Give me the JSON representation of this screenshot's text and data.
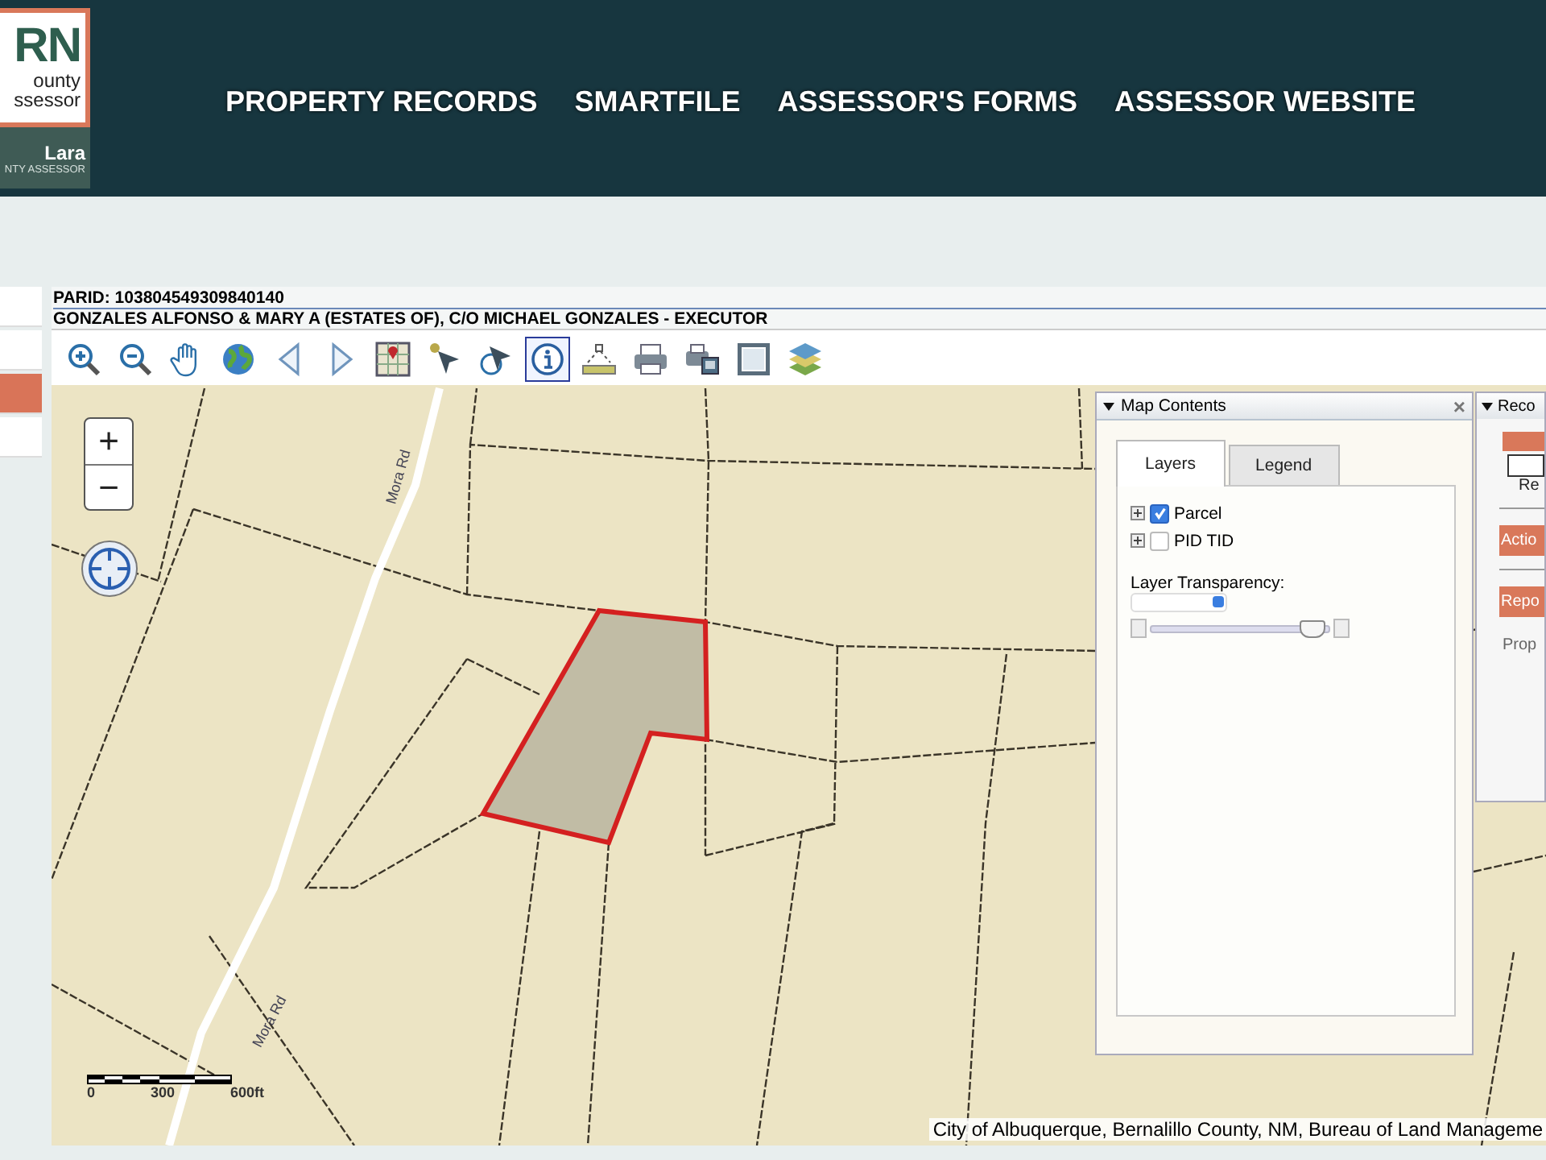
{
  "header": {
    "logo": {
      "letters": "RN",
      "line_1": "ounty",
      "line_2": "ssessor",
      "name": "Lara",
      "subtitle": "NTY ASSESSOR"
    },
    "nav": [
      "PROPERTY RECORDS",
      "SMARTFILE",
      "ASSESSOR'S FORMS",
      "ASSESSOR WEBSITE"
    ]
  },
  "left_panel": {
    "items": [
      {
        "selected": false
      },
      {
        "selected": false
      },
      {
        "selected": true
      },
      {
        "selected": false
      }
    ]
  },
  "record": {
    "parid": "PARID: 103804549309840140",
    "owner": "GONZALES ALFONSO & MARY A (ESTATES OF), C/O MICHAEL GONZALES - EXECUTOR"
  },
  "toolbar": [
    {
      "kind": "zoom-in",
      "selected": false
    },
    {
      "kind": "zoom-out",
      "selected": false
    },
    {
      "kind": "pan",
      "selected": false
    },
    {
      "kind": "globe",
      "selected": false
    },
    {
      "kind": "back",
      "selected": false
    },
    {
      "kind": "forward",
      "selected": false
    },
    {
      "kind": "map",
      "selected": false
    },
    {
      "kind": "select",
      "selected": false
    },
    {
      "kind": "select-point",
      "selected": false
    },
    {
      "kind": "info",
      "selected": true
    },
    {
      "kind": "measure",
      "selected": false
    },
    {
      "kind": "print",
      "selected": false
    },
    {
      "kind": "print-export",
      "selected": false
    },
    {
      "kind": "fullscreen",
      "selected": false
    },
    {
      "kind": "layers",
      "selected": false
    }
  ],
  "map": {
    "zoom_in": "+",
    "zoom_out": "−",
    "road_labels": [
      "Mora Rd",
      "Mora Rd"
    ],
    "scale": {
      "labels": [
        "0",
        "300",
        "600ft"
      ]
    },
    "attribution": "City of Albuquerque, Bernalillo County, NM, Bureau of Land Manageme",
    "map_contents": {
      "title": "Map Contents",
      "close": "×",
      "tabs": [
        {
          "label": "Layers",
          "selected": true
        },
        {
          "label": "Legend",
          "selected": false
        }
      ],
      "layers": [
        {
          "name": "Parcel",
          "checked": true
        },
        {
          "name": "PID TID",
          "checked": false
        }
      ],
      "transparency_label": "Layer Transparency:",
      "transparency": {
        "level": 0.9
      }
    },
    "record_panel": {
      "title": "Reco",
      "texts": [
        "Re",
        "Prop"
      ],
      "buttons": [
        "Actio",
        "Repo"
      ]
    }
  }
}
